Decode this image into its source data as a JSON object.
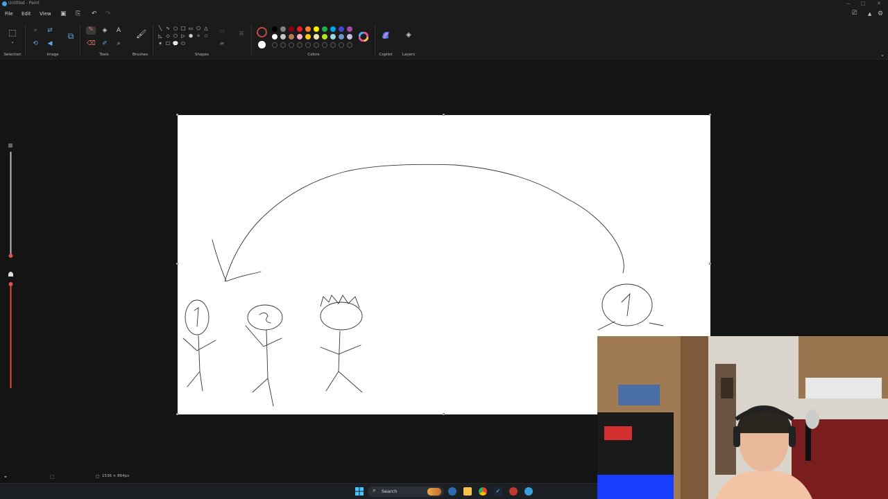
{
  "window": {
    "title": "Untitled - Paint",
    "minimize": "—",
    "maximize": "□",
    "close": "✕"
  },
  "menu": {
    "file": "File",
    "edit": "Edit",
    "view": "View"
  },
  "quick_access": {
    "save": "💾",
    "share": "⇪",
    "undo": "↶",
    "redo": "↷"
  },
  "ribbon": {
    "groups": {
      "selection": "Selection",
      "image": "Image",
      "tools": "Tools",
      "brushes": "Brushes",
      "shapes": "Shapes",
      "colors": "Colors",
      "copilot": "Copilot",
      "layers": "Layers"
    },
    "tools": {
      "pencil": "✎",
      "fill": "◈",
      "text": "A",
      "eraser": "⌫",
      "picker": "✐",
      "magnifier": "⌕"
    },
    "shapes": [
      "╲",
      "∿",
      "○",
      "□",
      "▭",
      "⬠",
      "△",
      "◺",
      "◇",
      "⬡",
      "▷",
      "⬢",
      "✧",
      "☆",
      "✶",
      "☐",
      "💬",
      "⬭"
    ],
    "colors": {
      "primary": "#1a1a1a",
      "secondary": "#ffffff",
      "row1": [
        "#000000",
        "#7f7f7f",
        "#880015",
        "#ed1c24",
        "#ff7f27",
        "#fff200",
        "#22b14c",
        "#00a2e8",
        "#3f48cc",
        "#a349a4"
      ],
      "row2": [
        "#ffffff",
        "#c3c3c3",
        "#b97a57",
        "#ffaec9",
        "#ffc90e",
        "#efe4b0",
        "#b5e61d",
        "#99d9ea",
        "#7092be",
        "#c8bfe7"
      ]
    }
  },
  "status": {
    "canvas_size": "1536 × 864px"
  },
  "taskbar": {
    "search": "Search",
    "start_icon": "windows-icon"
  },
  "canvas_state": {
    "zoom_slider_fill": 0.55,
    "brush_size_fill": 0.18
  }
}
